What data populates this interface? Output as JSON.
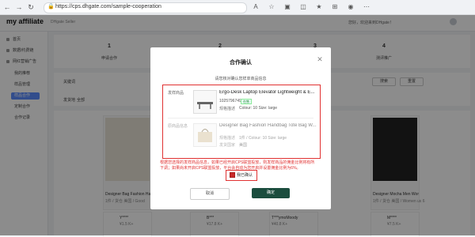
{
  "browser": {
    "url": "https://cps.dhgate.com/sample-cooperation",
    "profile_badge": "P"
  },
  "header": {
    "logo_text": "my affiliate",
    "logo_sub": "DHgate Seller",
    "welcome_text": "您好，欢迎来到DHgate！",
    "user_text": "ne"
  },
  "sidebar": {
    "items": [
      {
        "label": "首页"
      },
      {
        "label": "数据/约费链"
      },
      {
        "label": "网红营销广告"
      },
      {
        "label": "我的推荐"
      },
      {
        "label": "样品管理"
      },
      {
        "label": "样品合作"
      },
      {
        "label": "定制合作"
      },
      {
        "label": "合作记录"
      }
    ]
  },
  "steps": [
    {
      "num": "1",
      "label": "申请合作"
    },
    {
      "num": "2",
      "label": ""
    },
    {
      "num": "3",
      "label": ""
    },
    {
      "num": "4",
      "label": "测评推广"
    }
  ],
  "filters": {
    "label1": "关键词",
    "label2": "发货地",
    "label3": "全部",
    "search_btn": "搜索",
    "reset_btn": "重置"
  },
  "cards": [
    {
      "title": "Designer Bag Fashion Hand",
      "meta": "1件 / 货仓 美国 / Good",
      "name": "Y****",
      "price": "¥1.5 K+"
    },
    {
      "title": "",
      "meta": "",
      "name": "B***",
      "price": "¥17.8 K+"
    },
    {
      "title": "",
      "meta": "",
      "name": "T***ymoMoody",
      "price": "¥40.8 K+"
    },
    {
      "title": "Designer Mocha Men Women Ba",
      "meta": "1件 / 货仓 美国 / Women us 6",
      "name": "M****",
      "price": "¥7.5 K+"
    }
  ],
  "modal": {
    "title": "合作确认",
    "subtitle": "请您核对确认您样单商品信息",
    "product1": {
      "section_label": "发样商品",
      "title": "Ergo-Desk Laptop Elevator Lightweight & E...",
      "id": "1025796749",
      "tag": "在售",
      "key": "规格描述",
      "value": "Colour: 10 Size: large"
    },
    "product2": {
      "section_label": "原商品信息",
      "title": "Designer Bag Fashion Handbag Tote Bag W...",
      "key": "规格描述",
      "value": "1件 / Colour: 10 Size: large",
      "key2": "发货国家",
      "value2": "美国"
    },
    "warning": "根据您选择的发样商品信息，如果已经开启CPS联盟投放，则发样商品的佣金比例将有所下调；如果尚未开启CPS联盟投放，平台会自动为您开启并设置佣金比例为6%。",
    "checkbox_label": "我已确认",
    "cancel": "取消",
    "confirm": "确定"
  }
}
